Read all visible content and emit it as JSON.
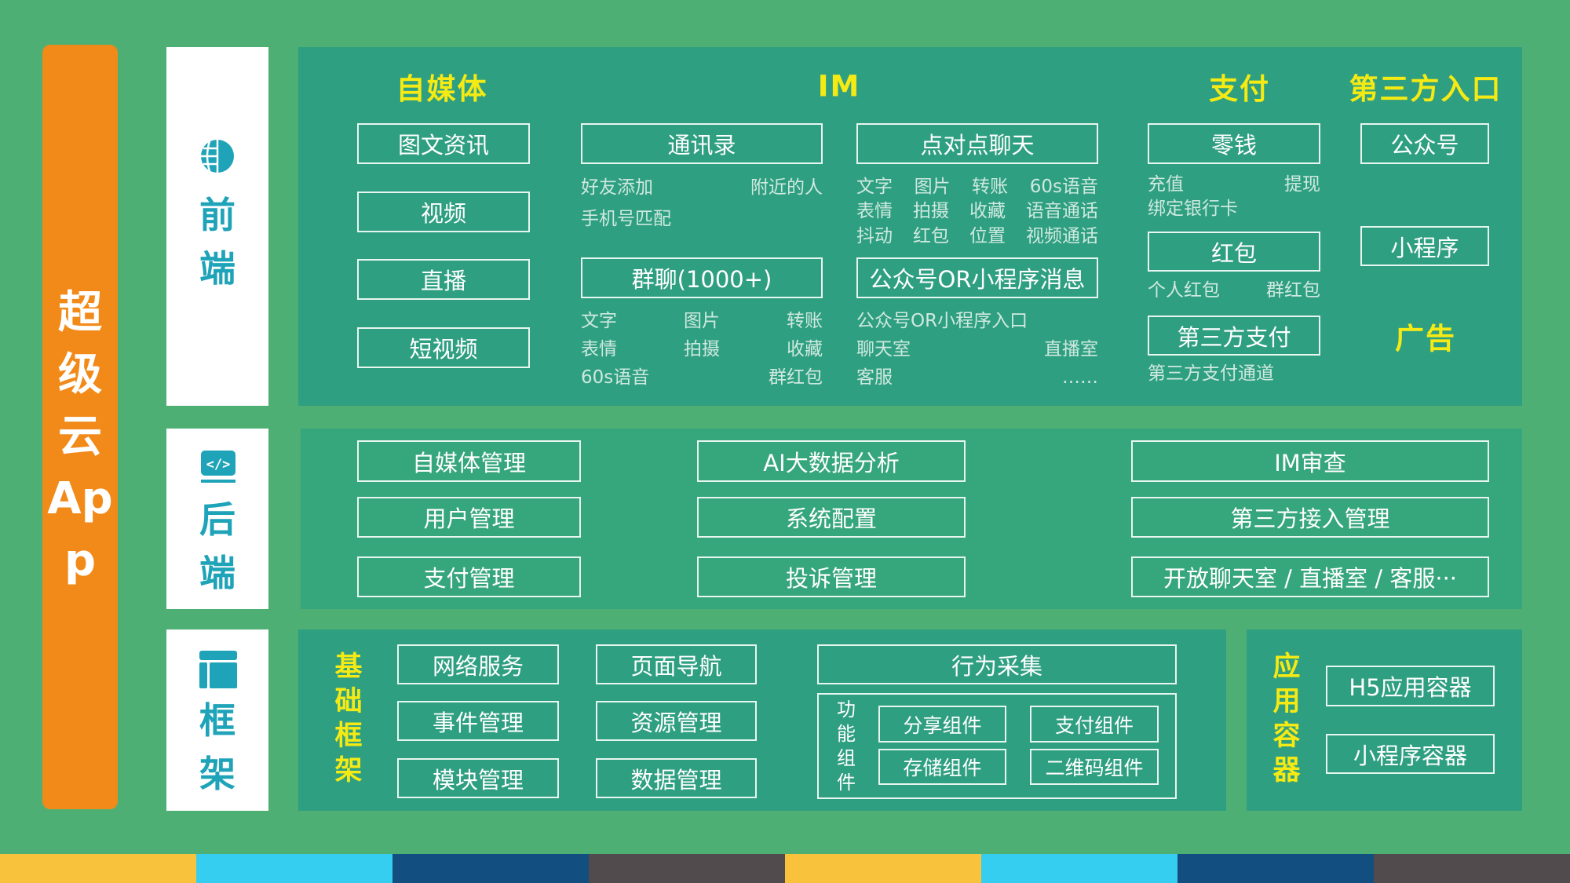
{
  "app_title": "超级云App",
  "colors": {
    "background": "#4daf74",
    "panel": "#2f9f82",
    "accent_orange": "#f28a1a",
    "heading_yellow": "#f5ea14",
    "side_teal": "#1ea3b8",
    "stripe": [
      "#f9c23c",
      "#35cdf0",
      "#124f80",
      "#514b4d"
    ]
  },
  "front": {
    "label": "前端",
    "icon": "globe-icon",
    "headers": {
      "media": "自媒体",
      "im": "IM",
      "pay": "支付",
      "third": "第三方入口"
    },
    "media": [
      "图文资讯",
      "视频",
      "直播",
      "短视频"
    ],
    "contacts": {
      "title": "通讯录",
      "line1": [
        "好友添加",
        "附近的人"
      ],
      "line2": [
        "手机号匹配"
      ]
    },
    "p2p": {
      "title": "点对点聊天",
      "line1": [
        "文字",
        "图片",
        "转账",
        "60s语音"
      ],
      "line2": [
        "表情",
        "拍摄",
        "收藏",
        "语音通话"
      ],
      "line3": [
        "抖动",
        "红包",
        "位置",
        "视频通话"
      ]
    },
    "group": {
      "title": "群聊(1000+)",
      "line1": [
        "文字",
        "图片",
        "转账"
      ],
      "line2": [
        "表情",
        "拍摄",
        "收藏"
      ],
      "line3": [
        "60s语音",
        "群红包"
      ]
    },
    "official": {
      "title": "公众号OR小程序消息",
      "line1": [
        "公众号OR小程序入口"
      ],
      "line2": [
        "聊天室",
        "直播室"
      ],
      "line3": [
        "客服",
        "……"
      ]
    },
    "change": {
      "title": "零钱",
      "line1": [
        "充值",
        "提现"
      ],
      "line2": [
        "绑定银行卡"
      ]
    },
    "redpacket": {
      "title": "红包",
      "line1": [
        "个人红包",
        "群红包"
      ]
    },
    "thirdpay": {
      "title": "第三方支付",
      "line1": [
        "第三方支付通道"
      ]
    },
    "entries": [
      "公众号",
      "小程序"
    ],
    "ads": "广告"
  },
  "back": {
    "label": "后端",
    "icon": "code-icon",
    "col1": [
      "自媒体管理",
      "用户管理",
      "支付管理"
    ],
    "col2": [
      "AI大数据分析",
      "系统配置",
      "投诉管理"
    ],
    "col3": [
      "IM审查",
      "第三方接入管理",
      "开放聊天室 / 直播室 / 客服···"
    ]
  },
  "framework": {
    "label": "框架",
    "icon": "layout-icon",
    "base_title": "基础框架",
    "col1": [
      "网络服务",
      "事件管理",
      "模块管理"
    ],
    "col2": [
      "页面导航",
      "资源管理",
      "数据管理"
    ],
    "behavior": "行为采集",
    "components_title": "功能组件",
    "components": [
      "分享组件",
      "支付组件",
      "存储组件",
      "二维码组件"
    ],
    "container_title": "应用容器",
    "containers": [
      "H5应用容器",
      "小程序容器"
    ]
  }
}
